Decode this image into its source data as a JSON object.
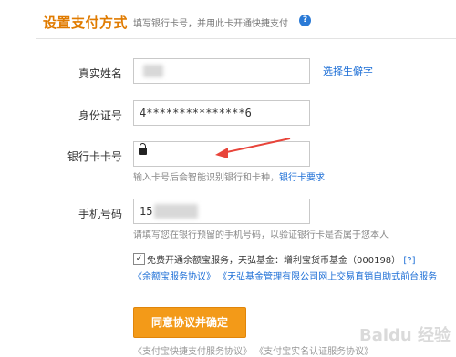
{
  "header": {
    "title": "设置支付方式",
    "subtitle": "填写银行卡号，并用此卡开通快捷支付",
    "help": "?"
  },
  "form": {
    "name_label": "真实姓名",
    "name_link": "选择生僻字",
    "id_label": "身份证号",
    "id_value": "4***************6",
    "card_label": "银行卡卡号",
    "card_hint": "输入卡号后会智能识别银行和卡种，",
    "card_hint_link": "银行卡要求",
    "phone_label": "手机号码",
    "phone_value": "15",
    "phone_hint": "请填写您在银行预留的手机号码，以验证银行卡是否属于您本人"
  },
  "agreement": {
    "checkbox_checked": true,
    "text": "免费开通余额宝服务，天弘基金：增利宝货币基金（000198）",
    "help": "[?]",
    "links": "《余额宝服务协议》 《天弘基金管理有限公司网上交易直销自助式前台服务"
  },
  "submit_label": "同意协议并确定",
  "bottom_links": "《支付宝快捷支付服务协议》 《支付宝实名认证服务协议》",
  "watermark": "Baidu 经验",
  "colors": {
    "accent": "#f39a18",
    "title": "#e07b00",
    "link": "#1c6ed6",
    "arrow": "#e8443a"
  }
}
